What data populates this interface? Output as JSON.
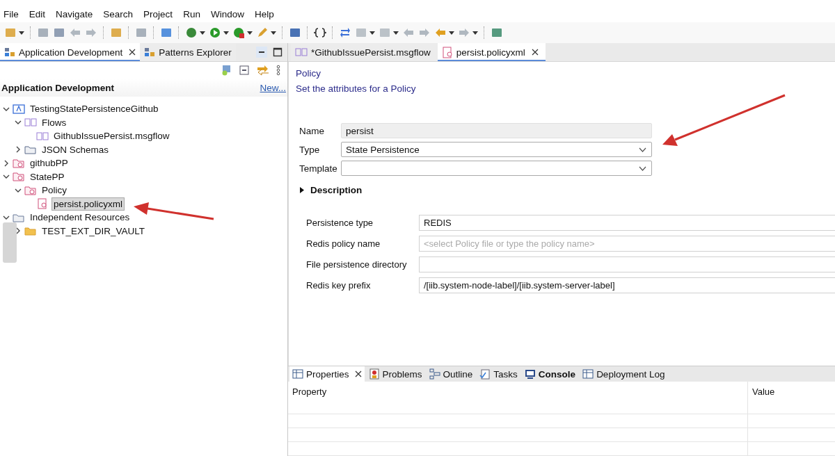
{
  "menu": [
    "File",
    "Edit",
    "Navigate",
    "Search",
    "Project",
    "Run",
    "Window",
    "Help"
  ],
  "left_panel": {
    "tabs": [
      {
        "label": "Application Development",
        "selected": true,
        "closable": true
      },
      {
        "label": "Patterns Explorer",
        "selected": false,
        "closable": false
      }
    ],
    "heading": "Application Development",
    "new_link": "New...",
    "tree": [
      {
        "label": "TestingStatePersistenceGithub",
        "kind": "app",
        "expanded": true,
        "selected": false,
        "children": [
          {
            "label": "Flows",
            "kind": "flows",
            "expanded": true,
            "selected": false,
            "children": [
              {
                "label": "GithubIssuePersist.msgflow",
                "kind": "msgflow",
                "selected": false
              }
            ]
          },
          {
            "label": "JSON Schemas",
            "kind": "schemas",
            "expanded": false,
            "selected": false
          }
        ]
      },
      {
        "label": "githubPP",
        "kind": "project",
        "expanded": false,
        "selected": false
      },
      {
        "label": "StatePP",
        "kind": "project",
        "expanded": true,
        "selected": false,
        "children": [
          {
            "label": "Policy",
            "kind": "policyfolder",
            "expanded": true,
            "selected": false,
            "children": [
              {
                "label": "persist.policyxml",
                "kind": "policy",
                "selected": true
              }
            ]
          }
        ]
      },
      {
        "label": "Independent Resources",
        "kind": "resources",
        "expanded": true,
        "selected": false,
        "children": [
          {
            "label": "TEST_EXT_DIR_VAULT",
            "kind": "folder",
            "expanded": false,
            "selected": false
          }
        ]
      }
    ]
  },
  "editor": {
    "tabs": [
      {
        "label": "*GithubIssuePersist.msgflow",
        "kind": "msgflow",
        "selected": false,
        "closable": false
      },
      {
        "label": "persist.policyxml",
        "kind": "policy",
        "selected": true,
        "closable": true
      }
    ],
    "title": "Policy",
    "subtitle": "Set the attributes for a Policy",
    "fields": [
      {
        "label": "Name",
        "value": "persist",
        "kind": "text",
        "readonly": true
      },
      {
        "label": "Type",
        "value": "State Persistence",
        "kind": "combo",
        "readonly": false
      },
      {
        "label": "Template",
        "kind": "combo",
        "readonly": false
      }
    ],
    "description": {
      "label": "Description",
      "expanded": false
    },
    "properties": [
      {
        "label": "Persistence type",
        "value": "REDIS"
      },
      {
        "label": "Redis policy name",
        "placeholder": "<select Policy file or type the policy name>"
      },
      {
        "label": "File persistence directory"
      },
      {
        "label": "Redis key prefix",
        "value": "/[iib.system-node-label]/[iib.system-server-label]"
      }
    ]
  },
  "bottom_panel": {
    "tabs": [
      {
        "label": "Properties",
        "kind": "properties",
        "selected": true,
        "closable": true,
        "bold": false
      },
      {
        "label": "Problems",
        "kind": "problems",
        "selected": false,
        "closable": false,
        "bold": false
      },
      {
        "label": "Outline",
        "kind": "outline",
        "selected": false,
        "closable": false,
        "bold": false
      },
      {
        "label": "Tasks",
        "kind": "tasks",
        "selected": false,
        "closable": false,
        "bold": false
      },
      {
        "label": "Console",
        "kind": "console",
        "selected": false,
        "closable": false,
        "bold": true
      },
      {
        "label": "Deployment Log",
        "kind": "log",
        "selected": false,
        "closable": false,
        "bold": false
      }
    ],
    "columns": [
      "Property",
      "Value"
    ]
  }
}
